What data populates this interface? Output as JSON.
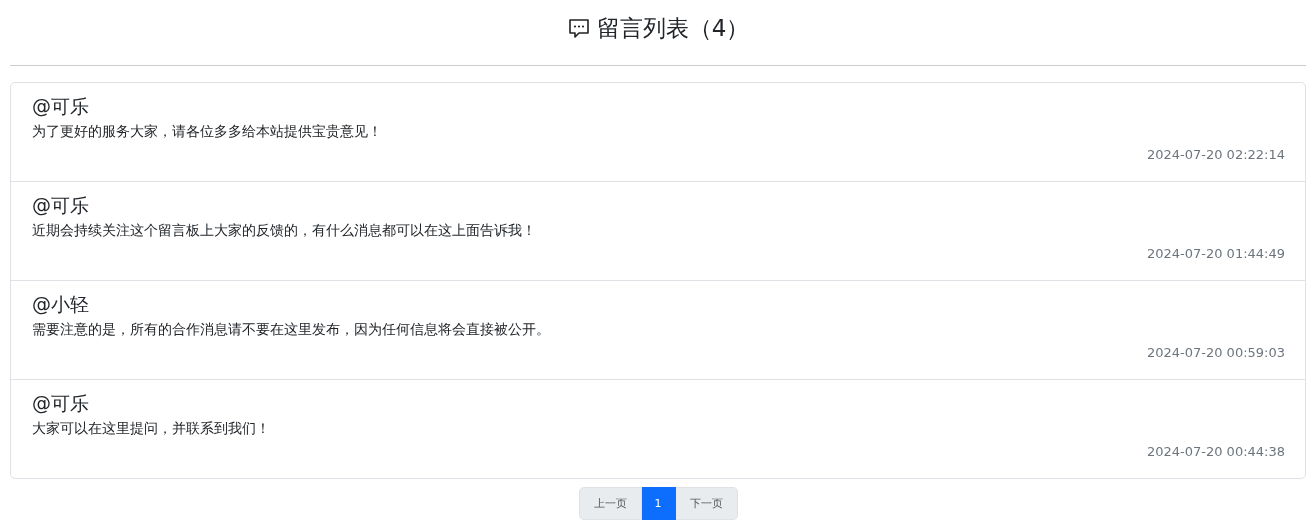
{
  "title": "留言列表（4）",
  "messages": [
    {
      "author": "@可乐",
      "text": "为了更好的服务大家，请各位多多给本站提供宝贵意见！",
      "time": "2024-07-20 02:22:14"
    },
    {
      "author": "@可乐",
      "text": "近期会持续关注这个留言板上大家的反馈的，有什么消息都可以在这上面告诉我！",
      "time": "2024-07-20 01:44:49"
    },
    {
      "author": "@小轻",
      "text": "需要注意的是，所有的合作消息请不要在这里发布，因为任何信息将会直接被公开。",
      "time": "2024-07-20 00:59:03"
    },
    {
      "author": "@可乐",
      "text": "大家可以在这里提问，并联系到我们！",
      "time": "2024-07-20 00:44:38"
    }
  ],
  "pagination": [
    {
      "label": "上一页",
      "selected": false
    },
    {
      "label": "1",
      "selected": true
    },
    {
      "label": "下一页",
      "selected": false
    }
  ]
}
